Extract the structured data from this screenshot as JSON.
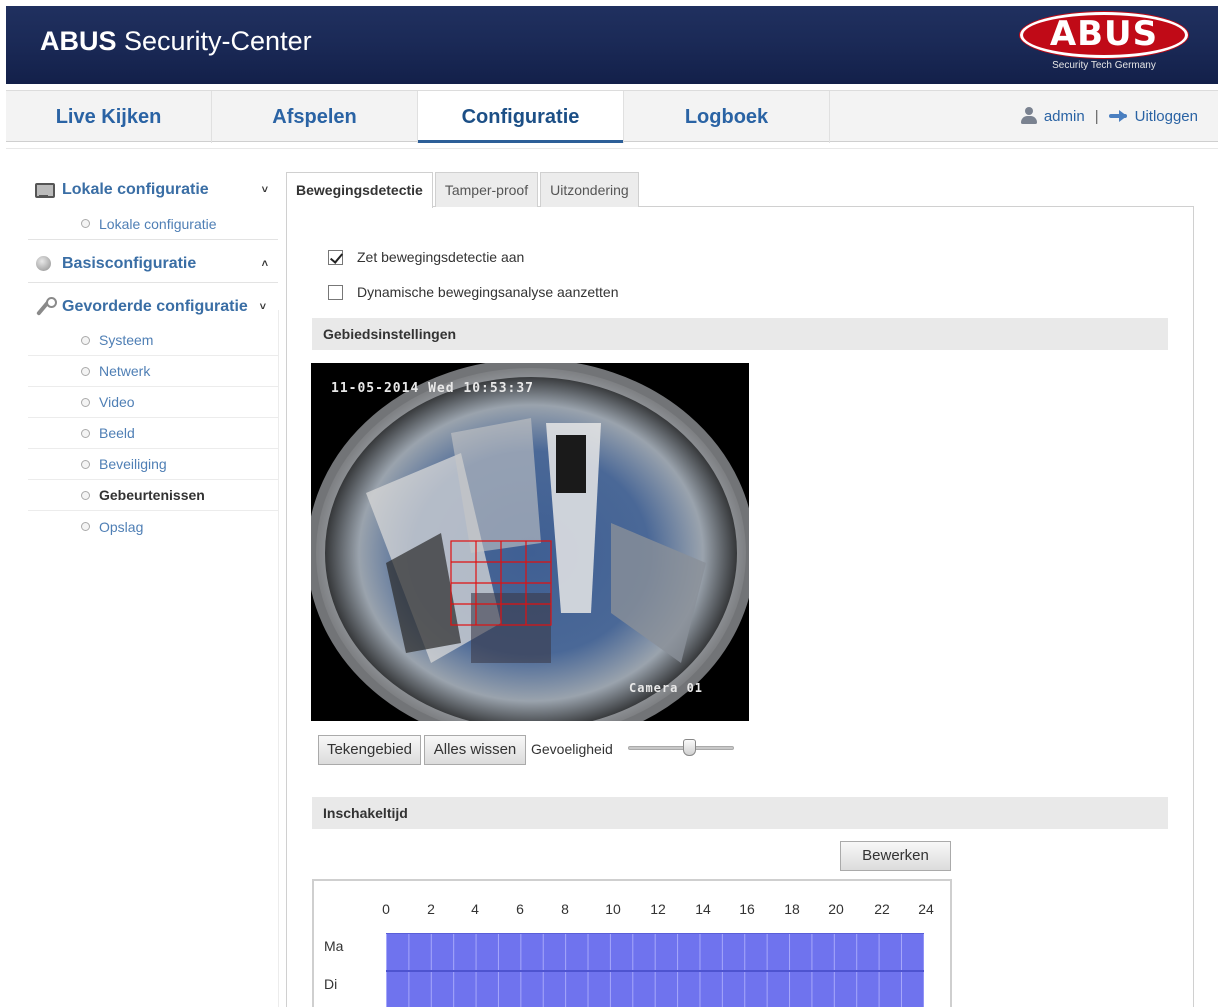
{
  "header": {
    "title_bold": "ABUS",
    "title_rest": " Security-Center",
    "logo_text": "ABUS",
    "logo_tagline": "Security Tech Germany"
  },
  "nav": {
    "tabs": [
      {
        "label": "Live Kijken"
      },
      {
        "label": "Afspelen"
      },
      {
        "label": "Configuratie"
      },
      {
        "label": "Logboek"
      }
    ],
    "active_tab": "Configuratie",
    "user": "admin",
    "separator": "|",
    "logout": "Uitloggen"
  },
  "sidebar": {
    "sections": [
      {
        "label": "Lokale configuratie",
        "chevron": "˅",
        "icon": "monitor-icon"
      },
      {
        "label": "Basisconfiguratie",
        "chevron": "˄",
        "icon": "globe-icon"
      },
      {
        "label": "Gevorderde configuratie",
        "chevron": "˅",
        "icon": "wrench-icon"
      }
    ],
    "local_items": [
      "Lokale configuratie"
    ],
    "advanced_items": [
      "Systeem",
      "Netwerk",
      "Video",
      "Beeld",
      "Beveiliging",
      "Gebeurtenissen",
      "Opslag"
    ],
    "active_item": "Gebeurtenissen"
  },
  "subtabs": [
    "Bewegingsdetectie",
    "Tamper-proof",
    "Uitzondering"
  ],
  "active_subtab": "Bewegingsdetectie",
  "motion": {
    "enable_label": "Zet bewegingsdetectie aan",
    "enable_checked": true,
    "dynamic_label": "Dynamische bewegingsanalyse aanzetten",
    "dynamic_checked": false
  },
  "area": {
    "heading": "Gebiedsinstellingen",
    "camera_timestamp": "11-05-2014 Wed 10:53:37",
    "camera_name": "Camera 01",
    "draw_button": "Tekengebied",
    "clear_button": "Alles wissen",
    "sensitivity_label": "Gevoeligheid",
    "sensitivity_fraction": 0.6
  },
  "schedule": {
    "heading": "Inschakeltijd",
    "edit_button": "Bewerken",
    "hours": [
      "0",
      "2",
      "4",
      "6",
      "8",
      "10",
      "12",
      "14",
      "16",
      "18",
      "20",
      "22",
      "24"
    ],
    "days": [
      "Ma",
      "Di"
    ],
    "bar_color": "#6f73ee"
  },
  "colors": {
    "header_bg": "#1b2a57",
    "logo_red": "#c00a17",
    "link_blue": "#2a63a4"
  }
}
